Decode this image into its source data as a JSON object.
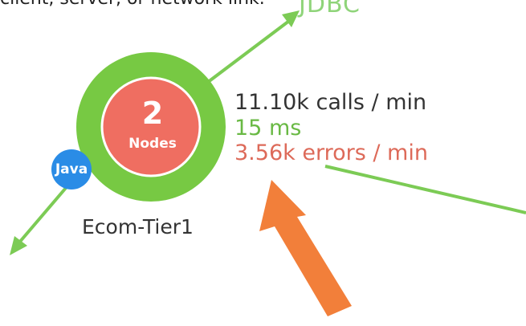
{
  "caption": "client, server, or network link.",
  "link_label": "JDBC",
  "node": {
    "count": "2",
    "count_label": "Nodes",
    "language_badge": "Java",
    "tier_name": "Ecom-Tier1"
  },
  "metrics": {
    "calls": "11.10k calls / min",
    "response_time": "15 ms",
    "errors": "3.56k errors / min"
  },
  "colors": {
    "link_green": "#7ccb55",
    "ring_green": "#77c943",
    "node_red": "#ef6e61",
    "java_blue": "#2a8ce6",
    "arrow_orange": "#f27f3a",
    "error_red": "#dd6a59",
    "latency_green": "#69b944"
  },
  "icons": {
    "java": "java-badge-icon",
    "arrow": "orange-pointer-arrow-icon",
    "link_arrowheads": "link-arrowhead-icon"
  }
}
